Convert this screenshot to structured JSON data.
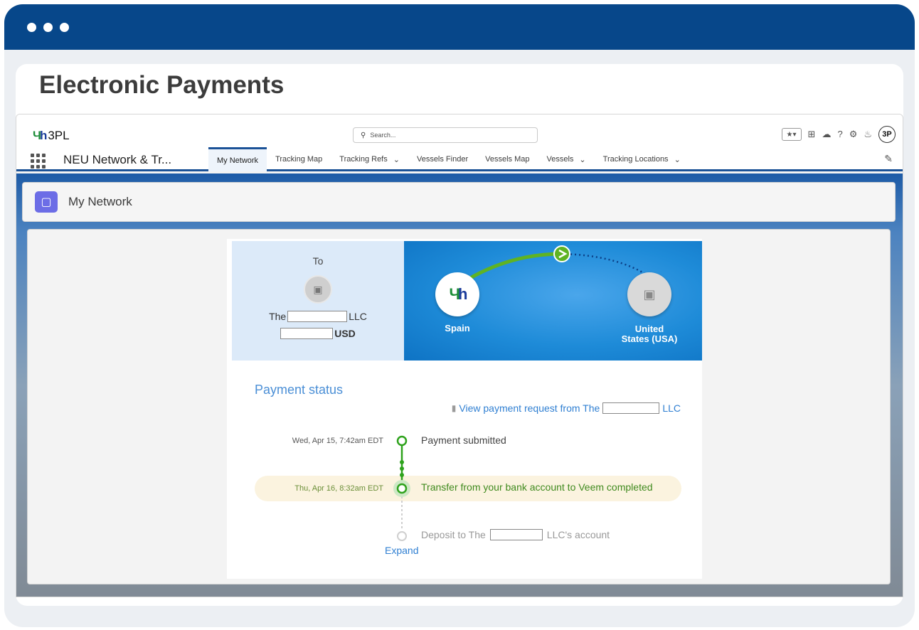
{
  "window": {
    "heading": "Electronic Payments"
  },
  "global_header": {
    "logo_text": "3PL",
    "search_placeholder": "Search...",
    "avatar_text": "3P"
  },
  "nav": {
    "app_name": "NEU Network & Tr...",
    "tabs": [
      {
        "label": "My Network",
        "active": true
      },
      {
        "label": "Tracking Map"
      },
      {
        "label": "Tracking Refs",
        "dropdown": true
      },
      {
        "label": "Vessels Finder"
      },
      {
        "label": "Vessels Map"
      },
      {
        "label": "Vessels",
        "dropdown": true
      },
      {
        "label": "Tracking Locations",
        "dropdown": true
      }
    ]
  },
  "page_header": {
    "title": "My Network"
  },
  "payment": {
    "to_label": "To",
    "to_name_prefix": "The",
    "to_name_suffix": "LLC",
    "currency": "USD",
    "origin": "Spain",
    "destination": "United States (USA)",
    "status_title": "Payment status",
    "view_request_prefix": "View payment request from The",
    "view_request_suffix": "LLC",
    "steps": [
      {
        "date": "Wed, Apr 15, 7:42am EDT",
        "text": "Payment submitted",
        "state": "done"
      },
      {
        "date": "Thu, Apr 16, 8:32am EDT",
        "text": "Transfer from your bank account to Veem completed",
        "state": "current"
      },
      {
        "date": "",
        "text_prefix": "Deposit to The",
        "text_suffix": "LLC's account",
        "state": "pending"
      }
    ],
    "expand_label": "Expand"
  },
  "colors": {
    "titlebar": "#07478a",
    "accent_green": "#2ea21c",
    "link_blue": "#2f7fd2"
  }
}
